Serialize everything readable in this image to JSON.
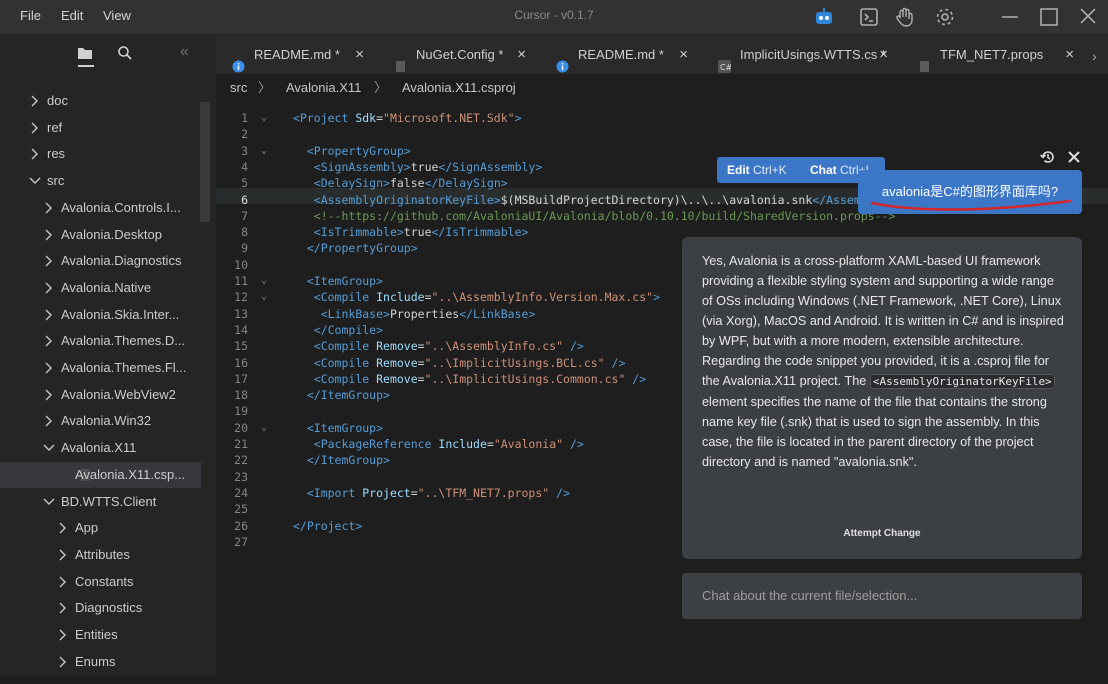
{
  "menu": [
    "File",
    "Edit",
    "View"
  ],
  "title": "Cursor - v0.1.7",
  "top_icons": [
    "robot-icon",
    "terminal-icon",
    "hand-icon",
    "gear-icon"
  ],
  "tree": [
    {
      "label": "doc",
      "indent": 0,
      "kind": "folder",
      "open": false
    },
    {
      "label": "ref",
      "indent": 0,
      "kind": "folder",
      "open": false
    },
    {
      "label": "res",
      "indent": 0,
      "kind": "folder",
      "open": false
    },
    {
      "label": "src",
      "indent": 0,
      "kind": "folder",
      "open": true
    },
    {
      "label": "Avalonia.Controls.I...",
      "indent": 1,
      "kind": "folder",
      "open": false
    },
    {
      "label": "Avalonia.Desktop",
      "indent": 1,
      "kind": "folder",
      "open": false
    },
    {
      "label": "Avalonia.Diagnostics",
      "indent": 1,
      "kind": "folder",
      "open": false
    },
    {
      "label": "Avalonia.Native",
      "indent": 1,
      "kind": "folder",
      "open": false
    },
    {
      "label": "Avalonia.Skia.Inter...",
      "indent": 1,
      "kind": "folder",
      "open": false
    },
    {
      "label": "Avalonia.Themes.D...",
      "indent": 1,
      "kind": "folder",
      "open": false
    },
    {
      "label": "Avalonia.Themes.Fl...",
      "indent": 1,
      "kind": "folder",
      "open": false
    },
    {
      "label": "Avalonia.WebView2",
      "indent": 1,
      "kind": "folder",
      "open": false
    },
    {
      "label": "Avalonia.Win32",
      "indent": 1,
      "kind": "folder",
      "open": false
    },
    {
      "label": "Avalonia.X11",
      "indent": 1,
      "kind": "folder",
      "open": true
    },
    {
      "label": "Avalonia.X11.csp...",
      "indent": 2,
      "kind": "file",
      "open": false
    },
    {
      "label": "BD.WTTS.Client",
      "indent": 1,
      "kind": "folder",
      "open": true
    },
    {
      "label": "App",
      "indent": 2,
      "kind": "folder",
      "open": false
    },
    {
      "label": "Attributes",
      "indent": 2,
      "kind": "folder",
      "open": false
    },
    {
      "label": "Constants",
      "indent": 2,
      "kind": "folder",
      "open": false
    },
    {
      "label": "Diagnostics",
      "indent": 2,
      "kind": "folder",
      "open": false
    },
    {
      "label": "Entities",
      "indent": 2,
      "kind": "folder",
      "open": false
    },
    {
      "label": "Enums",
      "indent": 2,
      "kind": "folder",
      "open": false
    }
  ],
  "tabs": [
    {
      "label": "README.md *",
      "icon": "info-icon",
      "close": "×"
    },
    {
      "label": "NuGet.Config *",
      "icon": "file-icon",
      "close": "×"
    },
    {
      "label": "README.md *",
      "icon": "info-icon",
      "close": "×"
    },
    {
      "label": "ImplicitUsings.WTTS.cs *",
      "icon": "cs-icon",
      "close": "×"
    },
    {
      "label": "TFM_NET7.props",
      "icon": "file-icon",
      "close": "×"
    }
  ],
  "breadcrumb": [
    "src",
    "Avalonia.X11",
    "Avalonia.X11.csproj"
  ],
  "code": [
    {
      "n": "1",
      "fold": "⌄",
      "t": [
        [
          "tg",
          "<Project "
        ],
        [
          "at",
          "Sdk"
        ],
        [
          "tx",
          "="
        ],
        [
          "st",
          "\"Microsoft.NET.Sdk\""
        ],
        [
          "tg",
          ">"
        ]
      ]
    },
    {
      "n": "2",
      "fold": "",
      "t": []
    },
    {
      "n": "3",
      "fold": "⌄",
      "t": [
        [
          "tx",
          "  "
        ],
        [
          "tg",
          "<PropertyGroup>"
        ]
      ]
    },
    {
      "n": "4",
      "fold": "",
      "t": [
        [
          "tx",
          "   "
        ],
        [
          "tg",
          "<SignAssembly>"
        ],
        [
          "tx",
          "true"
        ],
        [
          "tg",
          "</SignAssembly>"
        ]
      ]
    },
    {
      "n": "5",
      "fold": "",
      "t": [
        [
          "tx",
          "   "
        ],
        [
          "tg",
          "<DelaySign>"
        ],
        [
          "tx",
          "false"
        ],
        [
          "tg",
          "</DelaySign>"
        ]
      ]
    },
    {
      "n": "6",
      "fold": "",
      "t": [
        [
          "tx",
          "   "
        ],
        [
          "tg",
          "<AssemblyOriginatorKeyFile>"
        ],
        [
          "tx",
          "$(MSBuildProjectDirectory)\\..\\..\\avalonia.snk"
        ],
        [
          "tg",
          "</AssemblyOriginatorKeyFile>"
        ]
      ]
    },
    {
      "n": "7",
      "fold": "",
      "t": [
        [
          "tx",
          "   "
        ],
        [
          "cm",
          "<!--https://github.com/AvaloniaUI/Avalonia/blob/0.10.10/build/SharedVersion.props-->"
        ]
      ]
    },
    {
      "n": "8",
      "fold": "",
      "t": [
        [
          "tx",
          "   "
        ],
        [
          "tg",
          "<IsTrimmable>"
        ],
        [
          "tx",
          "true"
        ],
        [
          "tg",
          "</IsTrimmable>"
        ]
      ]
    },
    {
      "n": "9",
      "fold": "",
      "t": [
        [
          "tx",
          "  "
        ],
        [
          "tg",
          "</PropertyGroup>"
        ]
      ]
    },
    {
      "n": "10",
      "fold": "",
      "t": []
    },
    {
      "n": "11",
      "fold": "⌄",
      "t": [
        [
          "tx",
          "  "
        ],
        [
          "tg",
          "<ItemGroup>"
        ]
      ]
    },
    {
      "n": "12",
      "fold": "⌄",
      "t": [
        [
          "tx",
          "   "
        ],
        [
          "tg",
          "<Compile "
        ],
        [
          "at",
          "Include"
        ],
        [
          "tx",
          "="
        ],
        [
          "st",
          "\"..\\AssemblyInfo.Version.Max.cs\""
        ],
        [
          "tg",
          ">"
        ]
      ]
    },
    {
      "n": "13",
      "fold": "",
      "t": [
        [
          "tx",
          "    "
        ],
        [
          "tg",
          "<LinkBase>"
        ],
        [
          "tx",
          "Properties"
        ],
        [
          "tg",
          "</LinkBase>"
        ]
      ]
    },
    {
      "n": "14",
      "fold": "",
      "t": [
        [
          "tx",
          "   "
        ],
        [
          "tg",
          "</Compile>"
        ]
      ]
    },
    {
      "n": "15",
      "fold": "",
      "t": [
        [
          "tx",
          "   "
        ],
        [
          "tg",
          "<Compile "
        ],
        [
          "at",
          "Remove"
        ],
        [
          "tx",
          "="
        ],
        [
          "st",
          "\"..\\AssemblyInfo.cs\""
        ],
        [
          "tg",
          " />"
        ]
      ]
    },
    {
      "n": "16",
      "fold": "",
      "t": [
        [
          "tx",
          "   "
        ],
        [
          "tg",
          "<Compile "
        ],
        [
          "at",
          "Remove"
        ],
        [
          "tx",
          "="
        ],
        [
          "st",
          "\"..\\ImplicitUsings.BCL.cs\""
        ],
        [
          "tg",
          " />"
        ]
      ]
    },
    {
      "n": "17",
      "fold": "",
      "t": [
        [
          "tx",
          "   "
        ],
        [
          "tg",
          "<Compile "
        ],
        [
          "at",
          "Remove"
        ],
        [
          "tx",
          "="
        ],
        [
          "st",
          "\"..\\ImplicitUsings.Common.cs\""
        ],
        [
          "tg",
          " />"
        ]
      ]
    },
    {
      "n": "18",
      "fold": "",
      "t": [
        [
          "tx",
          "  "
        ],
        [
          "tg",
          "</ItemGroup>"
        ]
      ]
    },
    {
      "n": "19",
      "fold": "",
      "t": []
    },
    {
      "n": "20",
      "fold": "⌄",
      "t": [
        [
          "tx",
          "  "
        ],
        [
          "tg",
          "<ItemGroup>"
        ]
      ]
    },
    {
      "n": "21",
      "fold": "",
      "t": [
        [
          "tx",
          "   "
        ],
        [
          "tg",
          "<PackageReference "
        ],
        [
          "at",
          "Include"
        ],
        [
          "tx",
          "="
        ],
        [
          "st",
          "\"Avalonia\""
        ],
        [
          "tg",
          " />"
        ]
      ]
    },
    {
      "n": "22",
      "fold": "",
      "t": [
        [
          "tx",
          "  "
        ],
        [
          "tg",
          "</ItemGroup>"
        ]
      ]
    },
    {
      "n": "23",
      "fold": "",
      "t": []
    },
    {
      "n": "24",
      "fold": "",
      "t": [
        [
          "tx",
          "  "
        ],
        [
          "tg",
          "<Import "
        ],
        [
          "at",
          "Project"
        ],
        [
          "tx",
          "="
        ],
        [
          "st",
          "\"..\\TFM_NET7.props\""
        ],
        [
          "tg",
          " />"
        ]
      ]
    },
    {
      "n": "25",
      "fold": "",
      "t": []
    },
    {
      "n": "26",
      "fold": "",
      "t": [
        [
          "tg",
          "</Project>"
        ]
      ]
    },
    {
      "n": "27",
      "fold": "",
      "t": []
    }
  ],
  "ai_popup": {
    "edit_label": "Edit",
    "edit_shortcut": "Ctrl+K",
    "chat_label": "Chat",
    "chat_shortcut": "Ctrl+L",
    "user_message": "avalonia是C#的图形界面库吗?",
    "answer_p1": "Yes, Avalonia is a cross-platform XAML-based UI framework providing a flexible styling system and supporting a wide range of OSs including Windows (.NET Framework, .NET Core), Linux (via Xorg), MacOS and Android. It is written in C# and is inspired by WPF, but with a more modern, extensible architecture.",
    "answer_p2_pre": "Regarding the code snippet you provided, it is a .csproj file for the Avalonia.X11 project. The ",
    "answer_p2_code": "<AssemblyOriginatorKeyFile>",
    "answer_p2_post": " element specifies the name of the file that contains the strong name key file (.snk) that is used to sign the assembly. In this case, the file is located in the parent directory of the project directory and is named \"avalonia.snk\".",
    "attempt_change": "Attempt Change",
    "chat_placeholder": "Chat about the current file/selection..."
  },
  "colors": {
    "accent": "#3b76c7",
    "underline": "#d6262a"
  }
}
